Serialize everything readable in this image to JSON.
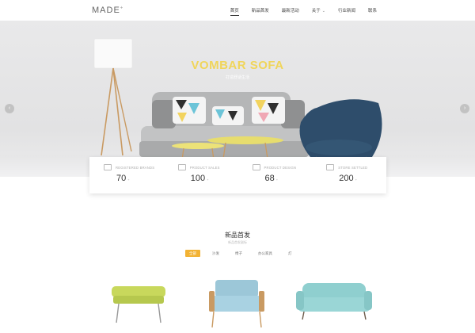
{
  "header": {
    "logo": "MADE",
    "logo_mark": "+",
    "nav": [
      {
        "label": "首页",
        "active": true
      },
      {
        "label": "新品首发"
      },
      {
        "label": "最新活动"
      },
      {
        "label": "关于",
        "dropdown": true
      },
      {
        "label": "行业新闻"
      },
      {
        "label": "联系"
      }
    ]
  },
  "hero": {
    "title": "VOMBAR SOFA",
    "subtitle": "打造舒适生活",
    "prev_icon": "chevron-left-icon",
    "next_icon": "chevron-right-icon"
  },
  "stats": [
    {
      "label": "REGISTERED BRANDS",
      "value": "70",
      "unit": "+",
      "icon": "car-icon"
    },
    {
      "label": "PRODUCT SALES",
      "value": "100",
      "unit": "+",
      "icon": "truck-icon"
    },
    {
      "label": "PRODUCT DESIGN",
      "value": "68",
      "unit": "+",
      "icon": "document-icon"
    },
    {
      "label": "STORE SETTLED",
      "value": "200",
      "unit": "+",
      "icon": "store-icon"
    }
  ],
  "section": {
    "title": "新品首发",
    "subtitle": "新品首发副标",
    "tabs": [
      {
        "label": "全部",
        "active": true
      },
      {
        "label": "沙发"
      },
      {
        "label": "椅子"
      },
      {
        "label": "办公家具"
      },
      {
        "label": "灯"
      }
    ]
  },
  "colors": {
    "accent": "#f2b233",
    "hero_title": "#f0d55a",
    "sofa": "#b9babb",
    "chair": "#2e4d6b"
  }
}
